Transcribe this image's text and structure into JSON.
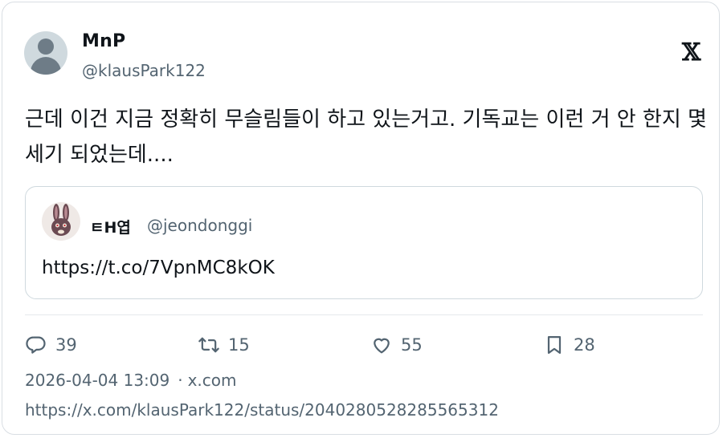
{
  "author": {
    "name": "MnP",
    "handle": "@klausPark122"
  },
  "brand_icon": "x-logo-icon",
  "tweet": {
    "text": "근데 이건 지금 정확히 무슬림들이 하고 있는거고. 기독교는 이런 거 안 한지 몇 세기 되었는데...."
  },
  "quoted": {
    "name": "ㅌH엽",
    "handle": "@jeondonggi",
    "link": "https://t.co/7VpnMC8kOK"
  },
  "stats": {
    "replies": "39",
    "retweets": "15",
    "likes": "55",
    "bookmarks": "28"
  },
  "meta": {
    "timestamp": "2026-04-04 13:09",
    "separator": "·",
    "source": "x.com"
  },
  "status_url": "https://x.com/klausPark122/status/2040280528285565312",
  "colors": {
    "text": "#0f1419",
    "muted": "#536471",
    "border": "#d9dee3",
    "avatar_bg": "#cfd9de"
  }
}
